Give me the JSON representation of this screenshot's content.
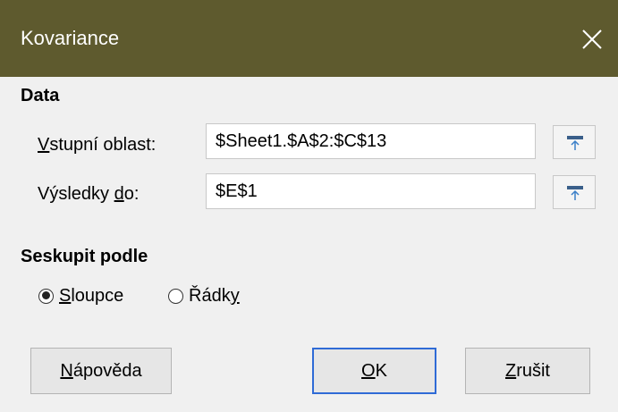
{
  "window": {
    "title": "Kovariance",
    "titlebar_color": "#5e5a2e"
  },
  "data_section": {
    "heading": "Data",
    "input_range": {
      "label_mnemonic": "V",
      "label_rest": "stupní oblast:",
      "value": "$Sheet1.$A$2:$C$13"
    },
    "results_to": {
      "label_pre": "Výsledky ",
      "label_mnemonic": "d",
      "label_post": "o:",
      "value": "$E$1"
    }
  },
  "grouping_section": {
    "heading": "Seskupit podle",
    "columns": {
      "label_mnemonic": "S",
      "label_rest": "loupce",
      "checked": true
    },
    "rows": {
      "label_pre": "Řádk",
      "label_mnemonic": "y",
      "checked": false
    }
  },
  "buttons": {
    "help": {
      "mnemonic": "N",
      "rest": "ápověda"
    },
    "ok": {
      "mnemonic": "O",
      "rest": "K"
    },
    "cancel": {
      "mnemonic": "Z",
      "rest": "rušit"
    }
  },
  "icons": {
    "close": "close-icon",
    "shrink": "shrink-dialog-icon"
  },
  "colors": {
    "accent": "#2f6bd6"
  }
}
